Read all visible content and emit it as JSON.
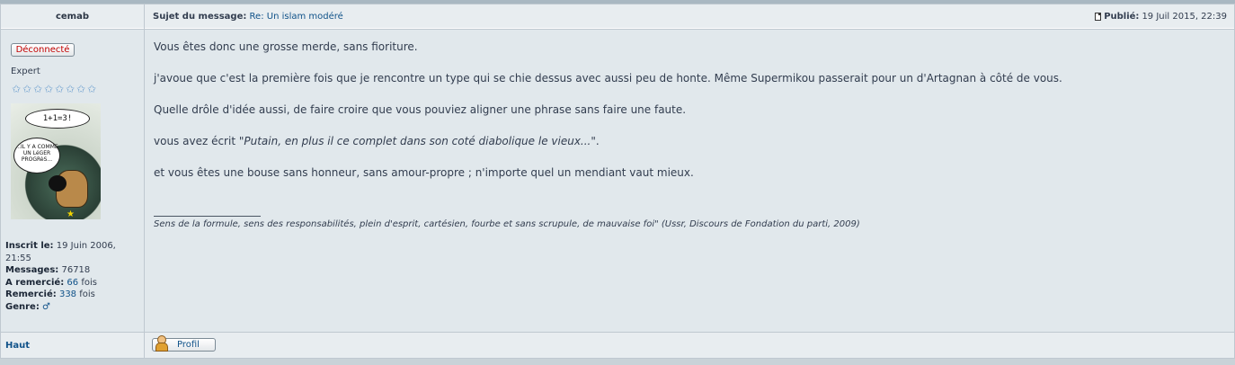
{
  "post": {
    "author": "cemab",
    "subject_label": "Sujet du message:",
    "subject": "Re: Un islam modéré",
    "posted_label": "Publié:",
    "posted_date": "19 Juil 2015, 22:39",
    "paragraphs": {
      "p1": "Vous êtes donc une grosse merde, sans fioriture.",
      "p2": "j'avoue que c'est la première fois que je rencontre un type qui se chie dessus avec aussi peu de honte. Même Supermikou passerait pour un d'Artagnan à côté de vous.",
      "p3": "Quelle drôle d'idée aussi, de faire croire que vous pouviez aligner une phrase sans faire une faute.",
      "p4_pre": "vous avez écrit \"",
      "p4_quote": "Putain, en plus il ce complet dans son coté diabolique le vieux...",
      "p4_post": "\".",
      "p5": "et vous êtes une bouse sans honneur, sans amour-propre ; n'importe quel un mendiant vaut mieux."
    },
    "signature": "Sens de la formule, sens des responsabilités, plein d'esprit, cartésien, fourbe et sans scrupule, de mauvaise foi\" (Ussr, Discours de Fondation du parti, 2009)"
  },
  "user": {
    "status": "Déconnecté",
    "rank": "Expert",
    "stars": 8,
    "avatar_text1": "1+1=3!",
    "avatar_text2": "...IL Y A COMME UN LéGER PROGRèS...",
    "registered_label": "Inscrit le:",
    "registered": "19 Juin 2006, 21:55",
    "messages_label": "Messages:",
    "messages": "76718",
    "thanked_label": "A remercié:",
    "thanked": "66",
    "thanked_suffix": "fois",
    "was_thanked_label": "Remercié:",
    "was_thanked": "338",
    "was_thanked_suffix": "fois",
    "gender_label": "Genre:",
    "gender_icon": "male-icon"
  },
  "footer": {
    "top_link": "Haut",
    "profile_button": "Profil"
  },
  "colors": {
    "link": "#105289",
    "offline": "#C20000",
    "panel": "#E1E8EC",
    "header": "#E8EDF0"
  }
}
